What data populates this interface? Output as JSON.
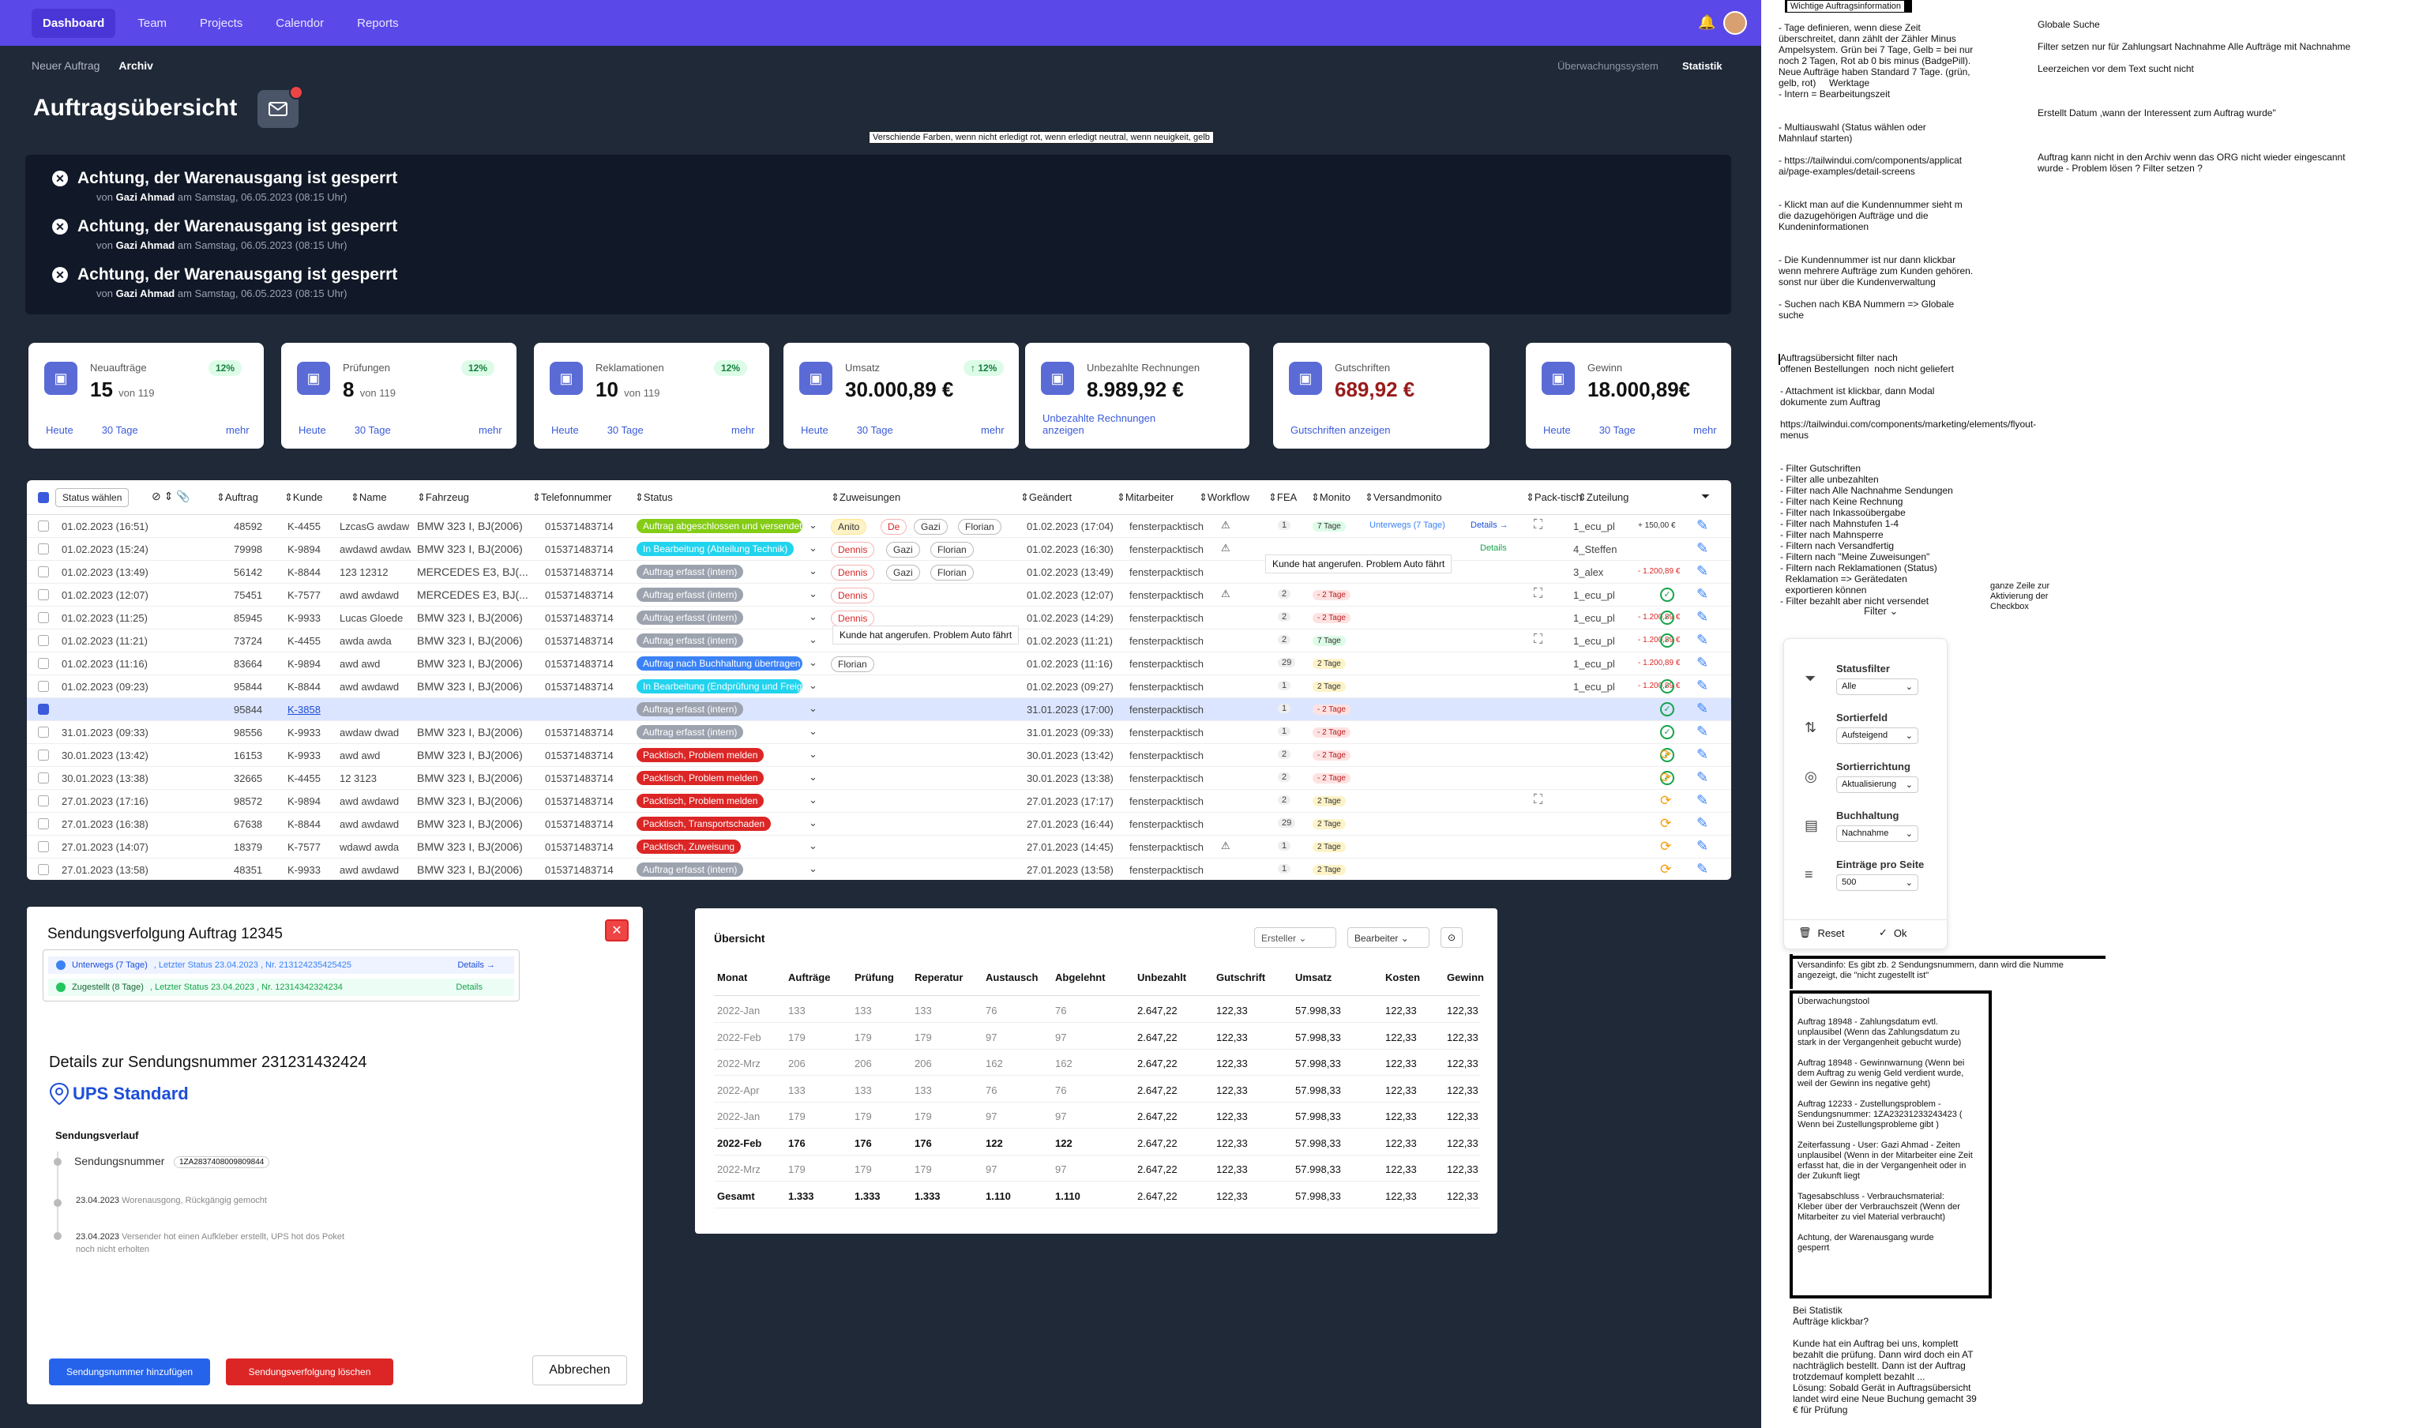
{
  "nav": {
    "items": [
      "Dashboard",
      "Team",
      "Projects",
      "Calendor",
      "Reports"
    ],
    "active": 0
  },
  "subnav": {
    "left": [
      "Neuer Auftrag",
      "Archiv"
    ],
    "active": 1,
    "right": [
      "Überwachungssystem",
      "Statistik"
    ]
  },
  "page_title": "Auftragsübersicht",
  "annotation_top": "Verschiende Farben, wenn nicht erledigt rot, wenn erledigt neutral, wenn neuigkeit, gelb",
  "notices": [
    {
      "title": "Achtung, der Warenausgang ist gesperrt",
      "by": "von",
      "author": "Gazi Ahmad",
      "date": "am Samstag, 06.05.2023 (08:15 Uhr)"
    },
    {
      "title": "Achtung, der Warenausgang ist gesperrt",
      "by": "von",
      "author": "Gazi Ahmad",
      "date": "am Samstag, 06.05.2023 (08:15 Uhr)"
    },
    {
      "title": "Achtung, der Warenausgang ist gesperrt",
      "by": "von",
      "author": "Gazi Ahmad",
      "date": "am Samstag, 06.05.2023 (08:15 Uhr)"
    }
  ],
  "cards": [
    {
      "label": "Neuaufträge",
      "value": "15",
      "sub": "von 119",
      "pct": "12%",
      "f1": "Heute",
      "f2": "30 Tage",
      "more": "mehr",
      "icon": "chevron-down-icon"
    },
    {
      "label": "Prüfungen",
      "value": "8",
      "sub": "von 119",
      "pct": "12%",
      "f1": "Heute",
      "f2": "30 Tage",
      "more": "mehr",
      "icon": "tools-icon"
    },
    {
      "label": "Reklamationen",
      "value": "10",
      "sub": "von 119",
      "pct": "12%",
      "f1": "Heute",
      "f2": "30 Tage",
      "more": "mehr",
      "icon": "info-icon"
    },
    {
      "label": "Umsatz",
      "value": "30.000,89 €",
      "sub": "",
      "pct": "↑ 12%",
      "f1": "Heute",
      "f2": "30 Tage",
      "more": "mehr",
      "icon": "cash-icon"
    },
    {
      "label": "Unbezahlte Rechnungen",
      "value": "8.989,92 €",
      "sub": "",
      "pct": "",
      "f1": "Unbezahlte Rechnungen anzeigen",
      "f2": "",
      "more": "",
      "icon": "card-icon"
    },
    {
      "label": "Gutschriften",
      "value": "689,92 €",
      "sub": "",
      "pct": "",
      "f1": "Gutschriften anzeigen",
      "f2": "",
      "more": "",
      "icon": "receipt-icon"
    },
    {
      "label": "Gewinn",
      "value": "18.000,89€",
      "sub": "",
      "pct": "",
      "f1": "Heute",
      "f2": "30 Tage",
      "more": "mehr",
      "icon": "euro-icon"
    }
  ],
  "table": {
    "status_select": "Status wählen",
    "headers": [
      "Auftrag",
      "Kunde",
      "Name",
      "Fahrzeug",
      "Telefonnummer",
      "Status",
      "Zuweisungen",
      "Geändert",
      "Mitarbeiter",
      "Workflow",
      "FEA",
      "Monito",
      "Versandmonito",
      "Pack-tisch",
      "Zuteilung"
    ],
    "rows": [
      {
        "date": "01.02.2023 (16:51)",
        "auftrag": "48592",
        "kunde": "K-4455",
        "name": "LzcasG awdaw",
        "fz": "BMW 323 I, BJ(2006)",
        "tel": "015371483714",
        "status": "Auftrag abgeschlossen und versendet",
        "sc": "#84cc16",
        "tags": [
          "Anito",
          "De",
          "Gazi",
          "Florian"
        ],
        "geand": "01.02.2023 (17:04)",
        "ma": "fensterpacktisch",
        "fea": "1",
        "mon": "7 Tage",
        "vm": "Unterwegs (7 Tage)",
        "vd": "Details →",
        "zut": "1_ecu_pl",
        "amt": "+ 150,00 €"
      },
      {
        "date": "01.02.2023 (15:24)",
        "auftrag": "79998",
        "kunde": "K-9894",
        "name": "awdawd awdaw",
        "fz": "BMW 323 I, BJ(2006)",
        "tel": "015371483714",
        "status": "In Bearbeitung (Abteilung Technik)",
        "sc": "#22d3ee",
        "tags": [
          "Dennis",
          "Gazi",
          "Florian"
        ],
        "geand": "01.02.2023 (16:30)",
        "ma": "fensterpacktisch",
        "fea": "",
        "mon": "",
        "vm": "",
        "vd": "Details",
        "zut": "4_Steffen",
        "amt": ""
      },
      {
        "date": "01.02.2023 (13:49)",
        "auftrag": "56142",
        "kunde": "K-8844",
        "name": "123 12312",
        "fz": "MERCEDES E3, BJ(...",
        "tel": "015371483714",
        "status": "Auftrag erfasst (intern)",
        "sc": "#9ca3af",
        "tags": [
          "Dennis",
          "Gazi",
          "Florian"
        ],
        "geand": "01.02.2023 (13:49)",
        "ma": "fensterpacktisch",
        "fea": "",
        "mon": "",
        "vm": "",
        "vd": "",
        "zut": "3_alex",
        "amt": "- 1.200,89 €"
      },
      {
        "date": "01.02.2023 (12:07)",
        "auftrag": "75451",
        "kunde": "K-7577",
        "name": "awd awdawd",
        "fz": "MERCEDES E3, BJ(...",
        "tel": "015371483714",
        "status": "Auftrag erfasst (intern)",
        "sc": "#9ca3af",
        "tags": [
          "Dennis"
        ],
        "geand": "01.02.2023 (12:07)",
        "ma": "fensterpacktisch",
        "fea": "2",
        "mon": "- 2 Tage",
        "vm": "",
        "vd": "",
        "zut": "1_ecu_pl",
        "amt": ""
      },
      {
        "date": "01.02.2023 (11:25)",
        "auftrag": "85945",
        "kunde": "K-9933",
        "name": "Lucas Gloede",
        "fz": "BMW 323 I, BJ(2006)",
        "tel": "015371483714",
        "status": "Auftrag erfasst (intern)",
        "sc": "#9ca3af",
        "tags": [
          "Dennis"
        ],
        "geand": "01.02.2023 (14:29)",
        "ma": "fensterpacktisch",
        "fea": "2",
        "mon": "- 2 Tage",
        "vm": "",
        "vd": "",
        "zut": "1_ecu_pl",
        "amt": "- 1.200,89 €"
      },
      {
        "date": "01.02.2023 (11:21)",
        "auftrag": "73724",
        "kunde": "K-4455",
        "name": "awda awda",
        "fz": "BMW 323 I, BJ(2006)",
        "tel": "015371483714",
        "status": "Auftrag erfasst (intern)",
        "sc": "#9ca3af",
        "tags": [],
        "geand": "01.02.2023 (11:21)",
        "ma": "fensterpacktisch",
        "fea": "2",
        "mon": "7 Tage",
        "vm": "",
        "vd": "",
        "zut": "1_ecu_pl",
        "amt": "- 1.200,89 €"
      },
      {
        "date": "01.02.2023 (11:16)",
        "auftrag": "83664",
        "kunde": "K-9894",
        "name": "awd awd",
        "fz": "BMW 323 I, BJ(2006)",
        "tel": "015371483714",
        "status": "Auftrag nach Buchhaltung übertragen",
        "sc": "#3b82f6",
        "tags": [
          "Florian"
        ],
        "geand": "01.02.2023 (11:16)",
        "ma": "fensterpacktisch",
        "fea": "29",
        "mon": "2 Tage",
        "vm": "",
        "vd": "",
        "zut": "1_ecu_pl",
        "amt": "- 1.200,89 €"
      },
      {
        "date": "01.02.2023 (09:23)",
        "auftrag": "95844",
        "kunde": "K-8844",
        "name": "awd awdawd",
        "fz": "BMW 323 I, BJ(2006)",
        "tel": "015371483714",
        "status": "In Bearbeitung (Endprüfung und Freigabe)",
        "sc": "#22d3ee",
        "tags": [],
        "geand": "01.02.2023 (09:27)",
        "ma": "fensterpacktisch",
        "fea": "1",
        "mon": "2 Tage",
        "vm": "",
        "vd": "",
        "zut": "1_ecu_pl",
        "amt": "- 1.200,89 €"
      },
      {
        "date": "",
        "auftrag": "95844",
        "kunde": "K-3858",
        "name": "",
        "fz": "",
        "tel": "",
        "status": "Auftrag erfasst (intern)",
        "sc": "#9ca3af",
        "tags": [],
        "geand": "31.01.2023 (17:00)",
        "ma": "fensterpacktisch",
        "fea": "1",
        "mon": "- 2 Tage",
        "vm": "",
        "vd": "",
        "zut": "",
        "amt": ""
      },
      {
        "date": "31.01.2023 (09:33)",
        "auftrag": "98556",
        "kunde": "K-9933",
        "name": "awdaw dwad",
        "fz": "BMW 323 I, BJ(2006)",
        "tel": "015371483714",
        "status": "Auftrag erfasst (intern)",
        "sc": "#9ca3af",
        "tags": [],
        "geand": "31.01.2023 (09:33)",
        "ma": "fensterpacktisch",
        "fea": "1",
        "mon": "- 2 Tage",
        "vm": "",
        "vd": "",
        "zut": "",
        "amt": ""
      },
      {
        "date": "30.01.2023 (13:42)",
        "auftrag": "16153",
        "kunde": "K-9933",
        "name": "awd awd",
        "fz": "BMW 323 I, BJ(2006)",
        "tel": "015371483714",
        "status": "Packtisch, Problem melden",
        "sc": "#dc2626",
        "tags": [],
        "geand": "30.01.2023 (13:42)",
        "ma": "fensterpacktisch",
        "fea": "2",
        "mon": "- 2 Tage",
        "vm": "",
        "vd": "",
        "zut": "",
        "amt": ""
      },
      {
        "date": "30.01.2023 (13:38)",
        "auftrag": "32665",
        "kunde": "K-4455",
        "name": "12 3123",
        "fz": "BMW 323 I, BJ(2006)",
        "tel": "015371483714",
        "status": "Packtisch, Problem melden",
        "sc": "#dc2626",
        "tags": [],
        "geand": "30.01.2023 (13:38)",
        "ma": "fensterpacktisch",
        "fea": "2",
        "mon": "- 2 Tage",
        "vm": "",
        "vd": "",
        "zut": "",
        "amt": ""
      },
      {
        "date": "27.01.2023 (17:16)",
        "auftrag": "98572",
        "kunde": "K-9894",
        "name": "awd awdawd",
        "fz": "BMW 323 I, BJ(2006)",
        "tel": "015371483714",
        "status": "Packtisch, Problem melden",
        "sc": "#dc2626",
        "tags": [],
        "geand": "27.01.2023 (17:17)",
        "ma": "fensterpacktisch",
        "fea": "2",
        "mon": "2 Tage",
        "vm": "",
        "vd": "",
        "zut": "",
        "amt": ""
      },
      {
        "date": "27.01.2023 (16:38)",
        "auftrag": "67638",
        "kunde": "K-8844",
        "name": "awd awdawd",
        "fz": "BMW 323 I, BJ(2006)",
        "tel": "015371483714",
        "status": "Packtisch, Transportschaden",
        "sc": "#dc2626",
        "tags": [],
        "geand": "27.01.2023 (16:44)",
        "ma": "fensterpacktisch",
        "fea": "29",
        "mon": "2 Tage",
        "vm": "",
        "vd": "",
        "zut": "",
        "amt": ""
      },
      {
        "date": "27.01.2023 (14:07)",
        "auftrag": "18379",
        "kunde": "K-7577",
        "name": "wdawd awda",
        "fz": "BMW 323 I, BJ(2006)",
        "tel": "015371483714",
        "status": "Packtisch, Zuweisung",
        "sc": "#dc2626",
        "tags": [],
        "geand": "27.01.2023 (14:45)",
        "ma": "fensterpacktisch",
        "fea": "1",
        "mon": "2 Tage",
        "vm": "",
        "vd": "",
        "zut": "",
        "amt": ""
      },
      {
        "date": "27.01.2023 (13:58)",
        "auftrag": "48351",
        "kunde": "K-9933",
        "name": "awd awdawd",
        "fz": "BMW 323 I, BJ(2006)",
        "tel": "015371483714",
        "status": "Auftrag erfasst (intern)",
        "sc": "#9ca3af",
        "tags": [],
        "geand": "27.01.2023 (13:58)",
        "ma": "fensterpacktisch",
        "fea": "1",
        "mon": "2 Tage",
        "vm": "",
        "vd": "",
        "zut": "",
        "amt": ""
      }
    ],
    "tooltip1": "Kunde hat angerufen. Problem Auto fährt",
    "tooltip2": "Kunde hat angerufen. Problem Auto fährt"
  },
  "tracking": {
    "title": "Sendungsverfolgung  Auftrag 12345",
    "status1": "Unterwegs (7 Tage)",
    "status1b": ", Letzter Status 23.04.2023 , Nr. 213124235425425",
    "status1d": "Details →",
    "status2": "Zugestellt (8 Tage)",
    "status2b": ", Letzter Status 23.04.2023 , Nr. 12314342324234",
    "status2d": "Details",
    "details_title": "Details  zur Sendungsnummer 231231432424",
    "carrier": "UPS Standard",
    "verlauf": "Sendungsverlauf",
    "sn_label": "Sendungsnummer",
    "sn_value": "1ZA2837408009809844",
    "e1_date": "23.04.2023",
    "e1_text": "Worenausgong, Rückgängig gemocht",
    "e2_date": "23.04.2023",
    "e2_text": "Versender hot einen Aufkleber erstellt, UPS hot dos Poket noch nicht erholten",
    "btn_add": "Sendungsnummer hinzufügen",
    "btn_del": "Sendungsverfolgung  löschen",
    "btn_cancel": "Abbrechen"
  },
  "overview": {
    "title": "Übersicht",
    "sel1": "Ersteller",
    "sel2": "Bearbeiter",
    "headers": [
      "Monat",
      "Aufträge",
      "Prüfung",
      "Reperatur",
      "Austausch",
      "Abgelehnt",
      "Unbezahlt",
      "Gutschrift",
      "Umsatz",
      "Kosten",
      "Gewinn"
    ],
    "rows": [
      [
        "2022-Jan",
        "133",
        "133",
        "133",
        "76",
        "76",
        "2.647,22",
        "122,33",
        "57.998,33",
        "122,33",
        "122,33"
      ],
      [
        "2022-Feb",
        "179",
        "179",
        "179",
        "97",
        "97",
        "2.647,22",
        "122,33",
        "57.998,33",
        "122,33",
        "122,33"
      ],
      [
        "2022-Mrz",
        "206",
        "206",
        "206",
        "162",
        "162",
        "2.647,22",
        "122,33",
        "57.998,33",
        "122,33",
        "122,33"
      ],
      [
        "2022-Apr",
        "133",
        "133",
        "133",
        "76",
        "76",
        "2.647,22",
        "122,33",
        "57.998,33",
        "122,33",
        "122,33"
      ],
      [
        "2022-Jan",
        "179",
        "179",
        "179",
        "97",
        "97",
        "2.647,22",
        "122,33",
        "57.998,33",
        "122,33",
        "122,33"
      ],
      [
        "2022-Feb",
        "176",
        "176",
        "176",
        "122",
        "122",
        "2.647,22",
        "122,33",
        "57.998,33",
        "122,33",
        "122,33"
      ],
      [
        "2022-Mrz",
        "179",
        "179",
        "179",
        "97",
        "97",
        "2.647,22",
        "122,33",
        "57.998,33",
        "122,33",
        "122,33"
      ],
      [
        "Gesamt",
        "1.333",
        "1.333",
        "1.333",
        "1.110",
        "1.110",
        "2.647,22",
        "122,33",
        "57.998,33",
        "122,33",
        "122,33"
      ]
    ]
  },
  "filter": {
    "label": "Filter",
    "items": [
      {
        "l": "Statusfilter",
        "v": "Alle"
      },
      {
        "l": "Sortierfeld",
        "v": "Aufsteigend"
      },
      {
        "l": "Sortierrichtung",
        "v": "Aktualisierung"
      },
      {
        "l": "Buchhaltung",
        "v": "Nachnahme"
      },
      {
        "l": "Einträge pro Seite",
        "v": "500"
      }
    ],
    "reset": "Reset",
    "ok": "Ok"
  },
  "notes": {
    "head": "Wichtige Auftragsinformation",
    "n1": "- Tage definieren, wenn diese Zeit\nüberschreitet, dann zählt der Zähler Minus\nAmpelsystem. Grün bei 7 Tage, Gelb = bei nur\nnoch 2 Tagen, Rot ab 0 bis minus (BadgePill).\nNeue Aufträge haben Standard 7 Tage. (grün,\ngelb, rot)     Werktage\n- Intern = Bearbeitungszeit\n\n\n- Multiauswahl (Status wählen oder\nMahnlauf starten)\n\n- https://tailwindui.com/components/applicat\nai/page-examples/detail-screens\n\n\n- Klickt man auf die Kundennummer sieht m\ndie dazugehörigen Aufträge und die\nKundeninformationen\n\n\n- Die Kundennummer ist nur dann klickbar\nwenn mehrere Aufträge zum Kunden gehören.\nsonst nur über die Kundenverwaltung\n\n- Suchen nach KBA Nummern => Globale\nsuche",
    "n2": "Auftragsübersicht filter nach\noffenen Bestellungen  noch nicht geliefert\n\n- Attachment ist klickbar, dann Modal\ndokumente zum Auftrag\n\nhttps://tailwindui.com/components/marketing/elements/flyout-menus\n\n\n- Filter Gutschriften\n- Filter alle unbezahlten\n- Filter nach Alle Nachnahme Sendungen\n- Filter nach Keine Rechnung\n- Filter nach Inkassoübergabe\n- Filter nach Mahnstufen 1-4\n- Filter nach Mahnsperre\n- Filtern nach Versandfertig\n- Filtern nach \"Meine Zuweisungen\"\n- Filtern nach Reklamationen (Status)\n  Reklamation => Gerätedaten\n  exportieren können\n- Filter bezahlt aber nicht versendet",
    "n3": "Globale Suche\n\nFilter setzen nur für Zahlungsart Nachnahme Alle Aufträge mit Nachnahme\n\nLeerzeichen vor dem Text sucht nicht\n\n\n\nErstellt Datum ,wann der Interessent zum Auftrag wurde\"\n\n\n\nAuftrag kann nicht in den Archiv wenn das ORG nicht wieder eingescannt\nwurde - Problem lösen ? Filter setzen ?",
    "n4": "ganze Zeile zur\nAktivierung der\nCheckbox",
    "n5": "Versandinfo: Es gibt zb. 2 Sendungsnummern, dann wird die Numme\nangezeigt, die \"nicht zugestellt ist\"",
    "n6": "Überwachungstool\n\nAuftrag 18948 - Zahlungsdatum evtl.\nunplausibel (Wenn das Zahlungsdatum zu\nstark in der Vergangenheit gebucht wurde)\n\nAuftrag 18948 - Gewinnwarnung (Wenn bei\ndem Auftrag zu wenig Geld verdient wurde,\nweil der Gewinn ins negative geht)\n\nAuftrag 12233 - Zustellungsproblem -\nSendungsnummer: 1ZA23231233243423 (\nWenn bei Zustellungsprobleme gibt )\n\nZeiterfassung - User: Gazi Ahmad - Zeiten\nunplausibel (Wenn in der Mitarbeiter eine Zeit\nerfasst hat, die in der Vergangenheit oder in\nder Zukunft liegt\n\nTagesabschluss - Verbrauchsmaterial:\nKleber über der Verbrauchszeit (Wenn der\nMitarbeiter zu viel Material verbraucht)\n\nAchtung, der Warenausgang wurde\ngesperrt",
    "n7": "Bei Statistik\nAufträge klickbar?\n\nKunde hat ein Auftrag bei uns, komplett\nbezahlt die prüfung. Dann wird doch ein AT\nnachträglich bestellt. Dann ist der Auftrag\ntrotzdemauf komplett bezahlt ...\nLösung: Sobald Gerät in Auftragsübersicht\nlandet wird eine Neue Buchung gemacht 39\n€ für Prüfung"
  }
}
